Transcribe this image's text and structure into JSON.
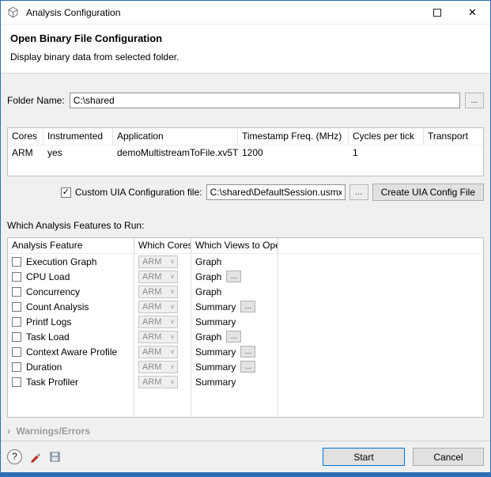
{
  "window": {
    "title": "Analysis Configuration",
    "close_icon": "✕"
  },
  "header": {
    "title": "Open Binary File Configuration",
    "subtitle": "Display binary data from selected folder."
  },
  "folder": {
    "label": "Folder Name:",
    "value": "C:\\shared"
  },
  "cores_table": {
    "columns": [
      "Cores",
      "Instrumented",
      "Application",
      "Timestamp Freq. (MHz)",
      "Cycles per tick",
      "Transport"
    ],
    "rows": [
      {
        "cores": "ARM",
        "instrumented": "yes",
        "application": "demoMultistreamToFile.xv5T",
        "timestamp_freq": "1200",
        "cycles_per_tick": "1",
        "transport": ""
      }
    ]
  },
  "uia": {
    "checkbox_label": "Custom UIA Configuration file:",
    "checked": true,
    "file_value": "C:\\shared\\DefaultSession.usmxml",
    "create_button": "Create UIA Config File"
  },
  "features": {
    "label": "Which Analysis Features to Run:",
    "columns": [
      "Analysis Feature",
      "Which Cores",
      "Which Views to Open"
    ],
    "rows": [
      {
        "feature": "Execution Graph",
        "cores": "ARM",
        "view": "Graph",
        "checked": false,
        "has_options": false
      },
      {
        "feature": "CPU Load",
        "cores": "ARM",
        "view": "Graph",
        "checked": false,
        "has_options": true
      },
      {
        "feature": "Concurrency",
        "cores": "ARM",
        "view": "Graph",
        "checked": false,
        "has_options": false
      },
      {
        "feature": "Count Analysis",
        "cores": "ARM",
        "view": "Summary",
        "checked": false,
        "has_options": true
      },
      {
        "feature": "Printf Logs",
        "cores": "ARM",
        "view": "Summary",
        "checked": false,
        "has_options": false
      },
      {
        "feature": "Task Load",
        "cores": "ARM",
        "view": "Graph",
        "checked": false,
        "has_options": true
      },
      {
        "feature": "Context Aware Profile",
        "cores": "ARM",
        "view": "Summary",
        "checked": false,
        "has_options": true
      },
      {
        "feature": "Duration",
        "cores": "ARM",
        "view": "Summary",
        "checked": false,
        "has_options": true
      },
      {
        "feature": "Task Profiler",
        "cores": "ARM",
        "view": "Summary",
        "checked": false,
        "has_options": false
      }
    ]
  },
  "warnings": {
    "expander_icon": "›",
    "label": "Warnings/Errors"
  },
  "footer": {
    "help_label": "?",
    "start_label": "Start",
    "cancel_label": "Cancel"
  },
  "ui": {
    "browse_label": "...",
    "options_label": "...",
    "chevron_icon": "∨",
    "check_icon": "✓"
  },
  "colors": {
    "accent_border": "#2e6db5",
    "default_button_border": "#0078d7"
  }
}
